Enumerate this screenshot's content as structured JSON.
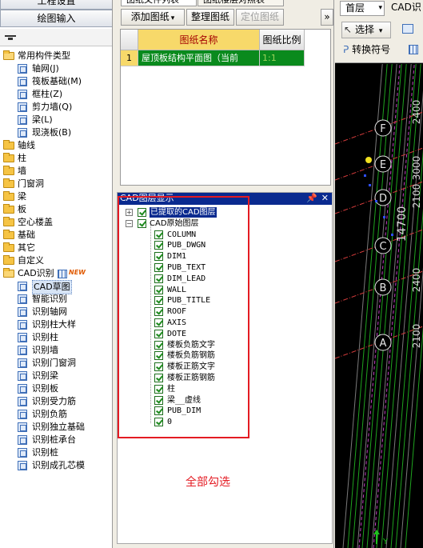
{
  "left": {
    "project_button": "工程设置",
    "draw_button": "绘图输入",
    "tree": [
      {
        "label": "常用构件类型",
        "kind": "folder-open",
        "level": 0
      },
      {
        "label": "轴网(J)",
        "kind": "comp",
        "level": 1
      },
      {
        "label": "筏板基础(M)",
        "kind": "comp",
        "level": 1
      },
      {
        "label": "框柱(Z)",
        "kind": "comp",
        "level": 1
      },
      {
        "label": "剪力墙(Q)",
        "kind": "comp",
        "level": 1
      },
      {
        "label": "梁(L)",
        "kind": "comp",
        "level": 1
      },
      {
        "label": "现浇板(B)",
        "kind": "comp",
        "level": 1
      },
      {
        "label": "轴线",
        "kind": "folder",
        "level": 0
      },
      {
        "label": "柱",
        "kind": "folder",
        "level": 0
      },
      {
        "label": "墙",
        "kind": "folder",
        "level": 0
      },
      {
        "label": "门窗洞",
        "kind": "folder",
        "level": 0
      },
      {
        "label": "梁",
        "kind": "folder",
        "level": 0
      },
      {
        "label": "板",
        "kind": "folder",
        "level": 0
      },
      {
        "label": "空心楼盖",
        "kind": "folder",
        "level": 0
      },
      {
        "label": "基础",
        "kind": "folder",
        "level": 0
      },
      {
        "label": "其它",
        "kind": "folder",
        "level": 0
      },
      {
        "label": "自定义",
        "kind": "folder",
        "level": 0
      },
      {
        "label": "CAD识别",
        "kind": "folder-open",
        "level": 0,
        "badge": "NEW"
      },
      {
        "label": "CAD草图",
        "kind": "comp",
        "level": 1,
        "selected": true
      },
      {
        "label": "智能识别",
        "kind": "comp",
        "level": 1
      },
      {
        "label": "识别轴网",
        "kind": "comp",
        "level": 1
      },
      {
        "label": "识别柱大样",
        "kind": "comp",
        "level": 1
      },
      {
        "label": "识别柱",
        "kind": "comp",
        "level": 1
      },
      {
        "label": "识别墙",
        "kind": "comp",
        "level": 1
      },
      {
        "label": "识别门窗洞",
        "kind": "comp",
        "level": 1
      },
      {
        "label": "识别梁",
        "kind": "comp",
        "level": 1
      },
      {
        "label": "识别板",
        "kind": "comp",
        "level": 1
      },
      {
        "label": "识别受力筋",
        "kind": "comp",
        "level": 1
      },
      {
        "label": "识别负筋",
        "kind": "comp",
        "level": 1
      },
      {
        "label": "识别独立基础",
        "kind": "comp",
        "level": 1
      },
      {
        "label": "识别桩承台",
        "kind": "comp",
        "level": 1
      },
      {
        "label": "识别桩",
        "kind": "comp",
        "level": 1
      },
      {
        "label": "识别成孔芯模",
        "kind": "comp",
        "level": 1
      }
    ]
  },
  "middle": {
    "tabs": [
      "图纸文件列表",
      "图纸楼层对照表"
    ],
    "toolbar": {
      "add": "添加图纸",
      "organize": "整理图纸",
      "locate": "定位图纸",
      "more": "»"
    },
    "table": {
      "headers": [
        "图纸名称",
        "图纸比例"
      ],
      "rows": [
        {
          "index": "1",
          "name": "屋顶板结构平面图（当前",
          "scale": "1:1"
        }
      ]
    },
    "layer_panel": {
      "title": "CAD图层显示",
      "pin": "📌",
      "close": "✕",
      "groups": [
        {
          "label": "已提取的CAD图层",
          "expanded": false,
          "highlight": true
        },
        {
          "label": "CAD原始图层",
          "expanded": true
        }
      ],
      "layers": [
        "COLUMN",
        "PUB_DWGN",
        "DIM1",
        "PUB_TEXT",
        "DIM_LEAD",
        "WALL",
        "PUB_TITLE",
        "ROOF",
        "AXIS",
        "DOTE",
        "楼板负筋文字",
        "楼板负筋钢筋",
        "楼板正筋文字",
        "楼板正筋钢筋",
        "柱",
        "梁__虚线",
        "PUB_DIM",
        "0"
      ]
    },
    "annotation": "全部勾选"
  },
  "right": {
    "floor_select": "首层",
    "cad_label": "CAD识",
    "select_button": "选择",
    "convert_button": "转换符号",
    "axis_letters": [
      "F",
      "E",
      "D",
      "C",
      "B",
      "A"
    ],
    "dims": [
      "14700",
      "2400",
      "3000",
      "2100",
      "2400",
      "2100"
    ],
    "axis_y": "Y"
  },
  "colors": {
    "cad_bg": "#000000",
    "highlight": "#0a2a8f",
    "annotation_red": "#e41b23",
    "row_green": "#0a8a1d"
  }
}
